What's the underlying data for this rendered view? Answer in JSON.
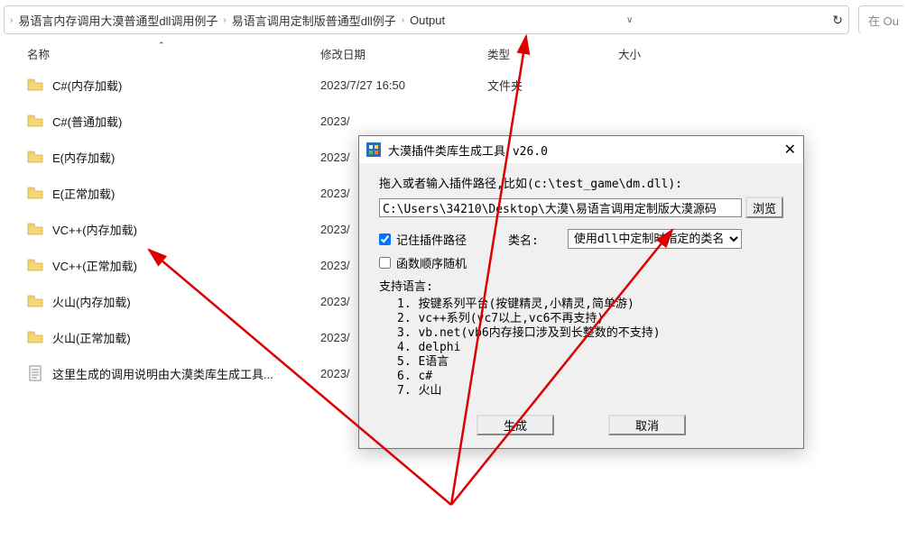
{
  "breadcrumbs": {
    "b1": "易语言内存调用大漠普通型dll调用例子",
    "b2": "易语言调用定制版普通型dll例子",
    "b3": "Output"
  },
  "search": {
    "prefix": "在 Ou"
  },
  "columns": {
    "name": "名称",
    "date": "修改日期",
    "type": "类型",
    "size": "大小"
  },
  "sort_indicator": "⌃",
  "files": [
    {
      "name": "C#(内存加载)",
      "date": "2023/7/27 16:50",
      "type": "文件夹",
      "icon": "folder"
    },
    {
      "name": "C#(普通加载)",
      "date": "2023/",
      "type": "",
      "icon": "folder"
    },
    {
      "name": "E(内存加载)",
      "date": "2023/",
      "type": "",
      "icon": "folder"
    },
    {
      "name": "E(正常加载)",
      "date": "2023/",
      "type": "",
      "icon": "folder"
    },
    {
      "name": "VC++(内存加载)",
      "date": "2023/",
      "type": "",
      "icon": "folder"
    },
    {
      "name": "VC++(正常加载)",
      "date": "2023/",
      "type": "",
      "icon": "folder"
    },
    {
      "name": "火山(内存加载)",
      "date": "2023/",
      "type": "",
      "icon": "folder"
    },
    {
      "name": "火山(正常加载)",
      "date": "2023/",
      "type": "",
      "icon": "folder"
    },
    {
      "name": "这里生成的调用说明由大漠类库生成工具...",
      "date": "2023/",
      "type": "",
      "icon": "text"
    }
  ],
  "dialog": {
    "title": "大漠插件类库生成工具  v26.0",
    "hint": "拖入或者输入插件路径,比如(c:\\test_game\\dm.dll):",
    "path_value": "C:\\Users\\34210\\Desktop\\大漠\\易语言调用定制版大漠源码",
    "browse": "浏览",
    "remember_label": "记住插件路径",
    "remember_checked": true,
    "classname_label": "类名:",
    "classname_value": "使用dll中定制时指定的类名",
    "random_label": "函数顺序随机",
    "random_checked": false,
    "support_title": "支持语言:",
    "support_items": [
      "1.  按键系列平台(按键精灵,小精灵,简单游)",
      "2.  vc++系列(vc7以上,vc6不再支持)",
      "3.  vb.net(vb6内存接口涉及到长整数的不支持)",
      "4.  delphi",
      "5.  E语言",
      "6.  c#",
      "7.  火山"
    ],
    "btn_generate": "生成",
    "btn_cancel": "取消"
  }
}
